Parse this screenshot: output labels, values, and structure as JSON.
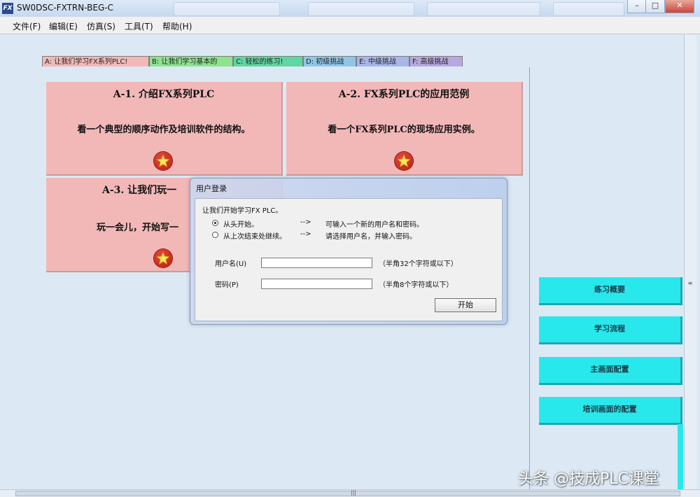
{
  "window": {
    "title": "SW0DSC-FXTRN-BEG-C",
    "app_icon": "FX",
    "controls": [
      "–",
      "□",
      "✕"
    ]
  },
  "menu": [
    "文件(F)",
    "编辑(E)",
    "仿真(S)",
    "工具(T)",
    "帮助(H)"
  ],
  "tabs": [
    {
      "label": "A: 让我们学习FX系列PLC!",
      "color": "#f2b8b8",
      "active": true
    },
    {
      "label": "B: 让我们学习基本的",
      "color": "#8ee38e",
      "active": false
    },
    {
      "label": "C: 轻松的练习!",
      "color": "#5fd6a3",
      "active": false
    },
    {
      "label": "D: 初级挑战",
      "color": "#8fc6e8",
      "active": false
    },
    {
      "label": "E: 中级挑战",
      "color": "#a8b6e8",
      "active": false
    },
    {
      "label": "F: 高级挑战",
      "color": "#b8a8de",
      "active": false
    }
  ],
  "cards": [
    {
      "title": "A-1. 介绍FX系列PLC",
      "desc": "看一个典型的顺序动作及培训软件的结构。"
    },
    {
      "title": "A-2. FX系列PLC的应用范例",
      "desc": "看一个FX系列PLC的现场应用实例。"
    },
    {
      "title": "A-3. 让我们玩一",
      "desc": "玩一会儿，开始写一"
    }
  ],
  "dialog": {
    "title": "用户登录",
    "intro": "让我们开始学习FX PLC。",
    "options": [
      {
        "label": "从头开始。",
        "arrow": "-->",
        "hint": "可输入一个新的用户名和密码。",
        "checked": true
      },
      {
        "label": "从上次结束处继续。",
        "arrow": "-->",
        "hint": "请选择用户名，并输入密码。",
        "checked": false
      }
    ],
    "username_label": "用户名(U)",
    "username_value": "",
    "username_hint": "（半角32个字符或以下）",
    "password_label": "密码(P)",
    "password_value": "",
    "password_hint": "（半角8个字符或以下）",
    "start_button": "开始"
  },
  "nav_buttons": [
    "练习概要",
    "学习流程",
    "主画面配置",
    "培训画面的配置"
  ],
  "watermark": "头条 @技成PLC课堂",
  "colors": {
    "card": "#f2b8b8",
    "nav_button": "#28e8ec",
    "background": "#dce9f5"
  }
}
